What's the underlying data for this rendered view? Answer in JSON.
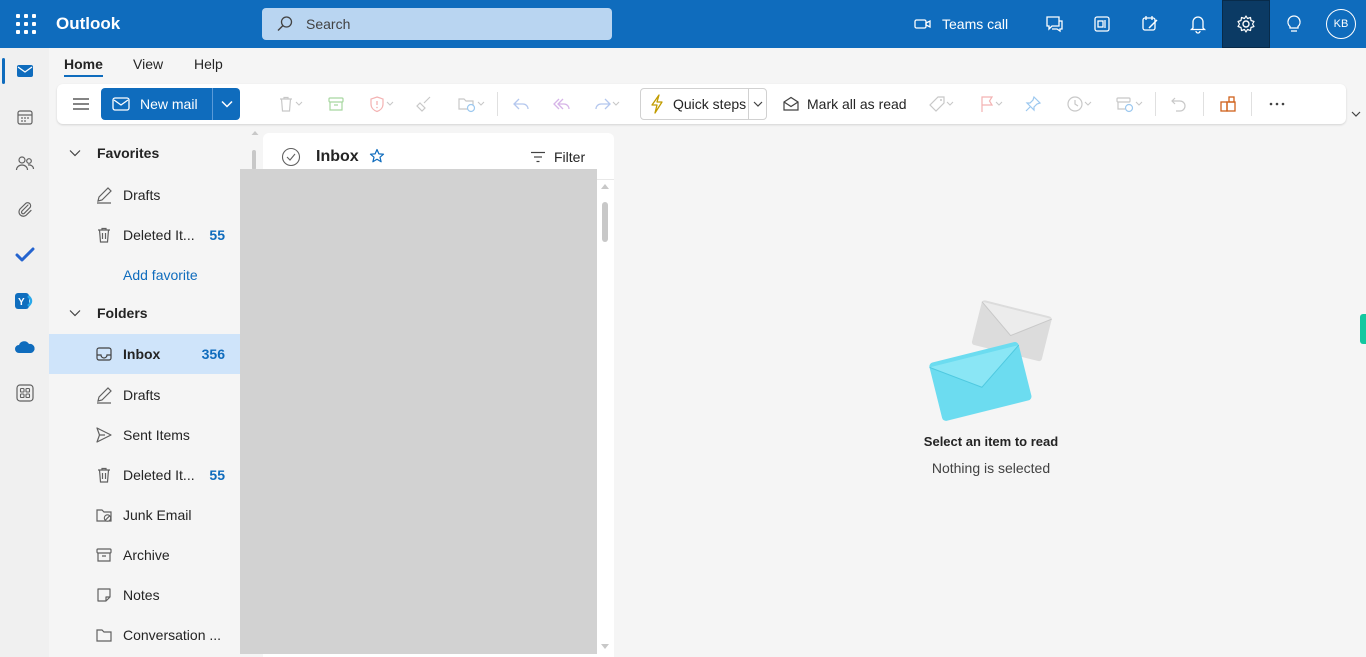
{
  "topbar": {
    "app_title": "Outlook",
    "search_placeholder": "Search",
    "teams_call_label": "Teams call",
    "avatar_initials": "KB",
    "accent_color": "#0f6cbd"
  },
  "ribbon_tabs": [
    "Home",
    "View",
    "Help"
  ],
  "ribbon": {
    "new_mail_label": "New mail",
    "quick_steps_label": "Quick steps",
    "mark_all_read_label": "Mark all as read"
  },
  "folder_pane": {
    "favorites_header": "Favorites",
    "favorites": [
      {
        "label": "Drafts",
        "count": ""
      },
      {
        "label": "Deleted It...",
        "count": "55"
      }
    ],
    "add_favorite_label": "Add favorite",
    "folders_header": "Folders",
    "folders": [
      {
        "label": "Inbox",
        "count": "356"
      },
      {
        "label": "Drafts",
        "count": ""
      },
      {
        "label": "Sent Items",
        "count": ""
      },
      {
        "label": "Deleted It...",
        "count": "55"
      },
      {
        "label": "Junk Email",
        "count": ""
      },
      {
        "label": "Archive",
        "count": ""
      },
      {
        "label": "Notes",
        "count": ""
      },
      {
        "label": "Conversation ...",
        "count": ""
      }
    ]
  },
  "message_list": {
    "title": "Inbox",
    "filter_label": "Filter"
  },
  "reading_pane": {
    "empty_title": "Select an item to read",
    "empty_subtitle": "Nothing is selected"
  }
}
